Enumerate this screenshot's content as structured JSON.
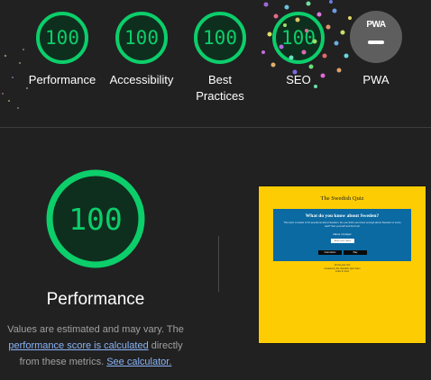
{
  "categories": [
    {
      "score": "100",
      "label": "Performance"
    },
    {
      "score": "100",
      "label": "Accessibility"
    },
    {
      "score": "100",
      "label_line1": "Best",
      "label_line2": "Practices"
    },
    {
      "score": "100",
      "label": "SEO"
    }
  ],
  "pwa": {
    "badge_text": "PWA",
    "label": "PWA"
  },
  "colors": {
    "pass": "#0cce6b",
    "pass_fill": "#0f2f1e",
    "background": "#212121",
    "link": "#8ab4f8"
  },
  "performance": {
    "score": "100",
    "title": "Performance",
    "desc_part1": "Values are estimated and may vary. The",
    "link1": "performance score is calculated",
    "desc_part2": "directly from these metrics.",
    "link2": "See calculator."
  },
  "screenshot": {
    "title": "The Swedish Quiz",
    "panel_title": "What do you know about Sweden?",
    "panel_text": "This Quiz consists of 10 questions about Sweden. Do you think you know enough about Sweden to score well? Test yourself and find out!",
    "name_label": "Name of player",
    "input_placeholder": "Enter your name",
    "button1": "Instructions",
    "button2": "Play",
    "footer_line1": "All the quiz info",
    "footer_line2": "Created by the Swedish Quiz team",
    "footer_line3": "Links & more"
  }
}
